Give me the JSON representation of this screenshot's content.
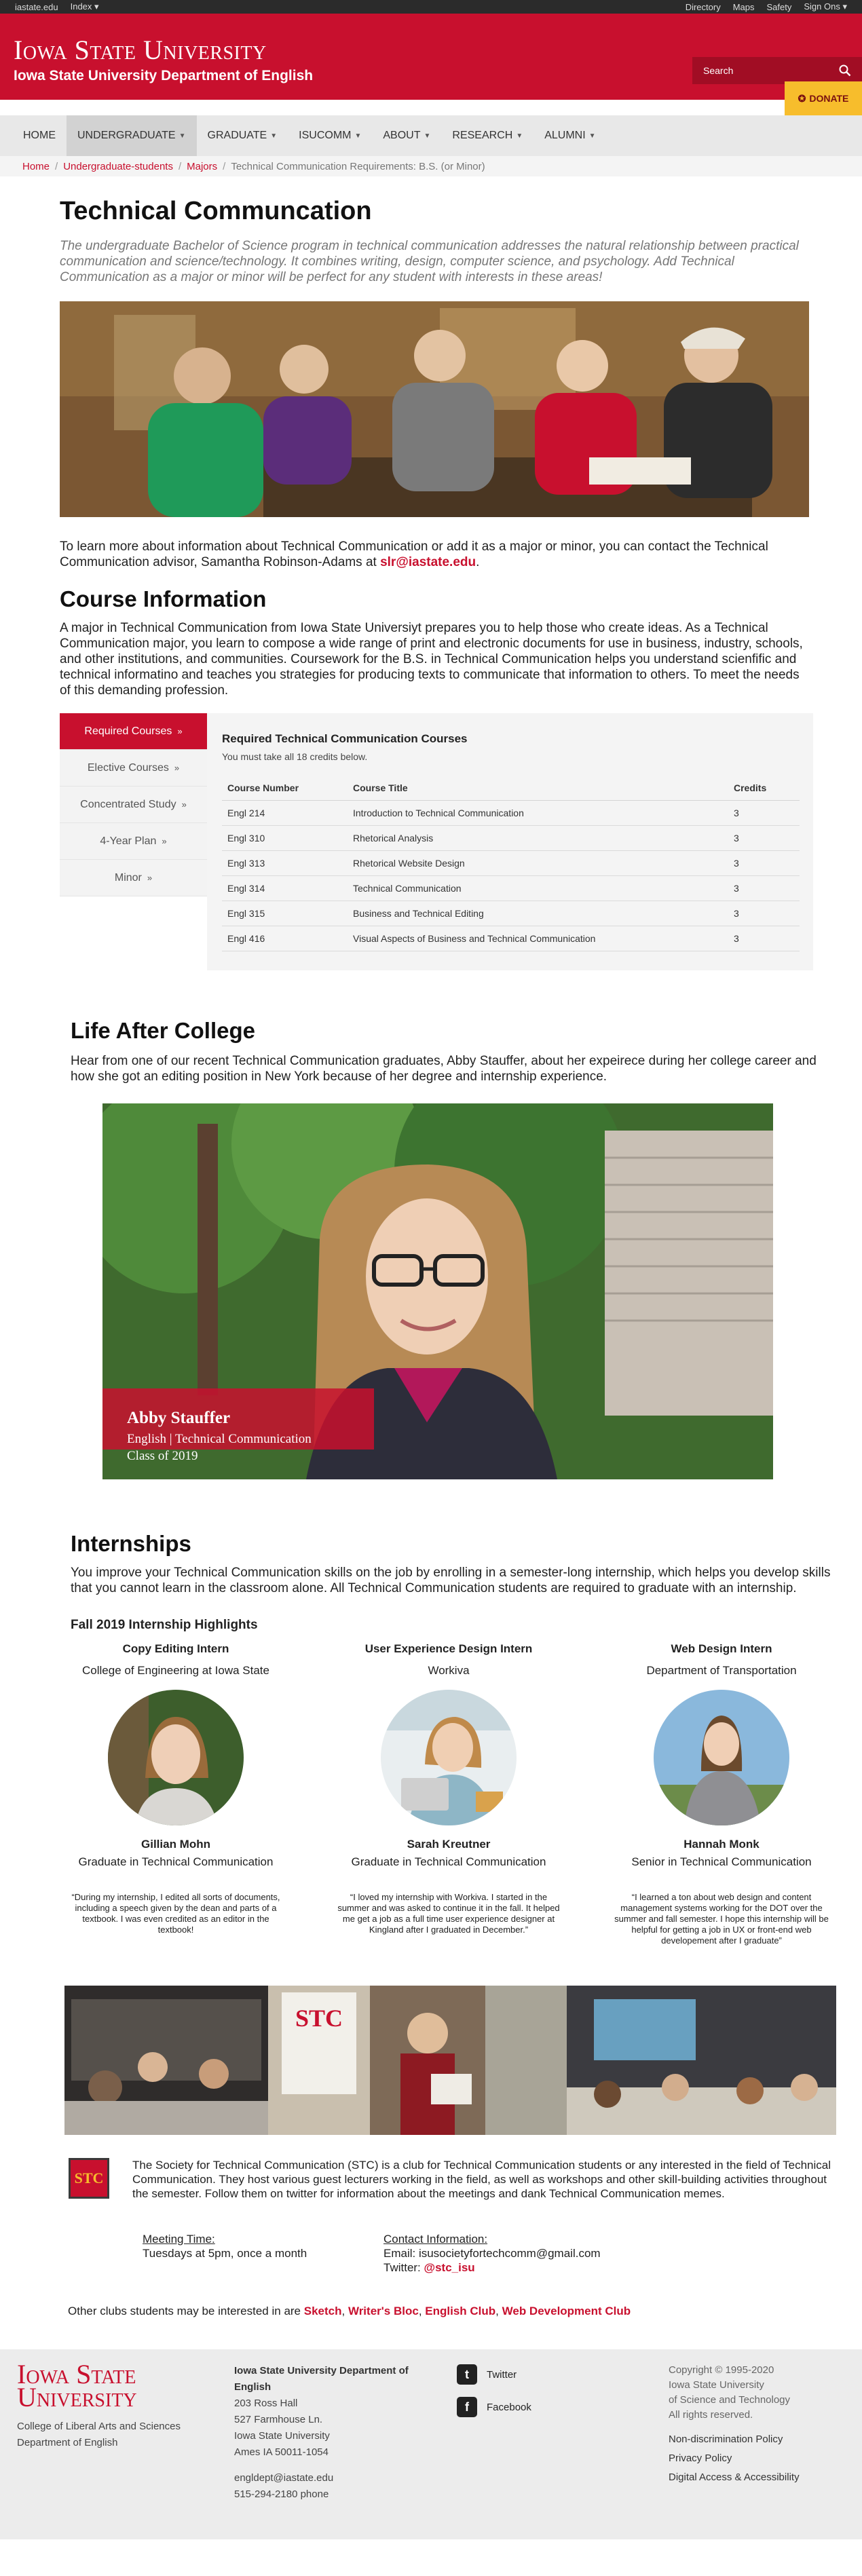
{
  "util": {
    "site": "iastate.edu",
    "index": "Index",
    "links": [
      "Directory",
      "Maps",
      "Safety",
      "Sign Ons"
    ]
  },
  "header": {
    "wordmark": "Iowa State University",
    "dept": "Iowa State University Department of English",
    "search_placeholder": "Search",
    "donate": "DONATE"
  },
  "nav": [
    "HOME",
    "UNDERGRADUATE",
    "GRADUATE",
    "ISUCOMM",
    "ABOUT",
    "RESEARCH",
    "ALUMNI"
  ],
  "breadcrumb": [
    "Home",
    "Undergraduate-students",
    "Majors",
    "Technical Communication Requirements: B.S. (or Minor)"
  ],
  "intro": {
    "title": "Technical Communcation",
    "lead": "The undergraduate Bachelor of Science program in technical communication addresses the natural relationship between practical communication and science/technology. It combines writing, design, computer science, and psychology. Add Technical Communication as a major or minor will be perfect for any student with interests in these areas!",
    "contact_text": "To learn more about information about Technical Communication or add it as a major or minor, you can contact the Technical Communication advisor, Samantha Robinson-Adams at ",
    "contact_email": "slr@iastate.edu",
    "contact_end": "."
  },
  "course_info": {
    "heading": "Course Information",
    "body": "A major in Technical Communication from Iowa State Universiyt prepares you to help those who create ideas. As a Technical Communication major, you learn to compose a wide range of print and electronic documents for use in business, industry, schools, and other institutions, and communities. Coursework for the B.S. in Technical Communication helps you understand scienfific and technical informatino and teaches you strategies for producing texts to communicate that information to others. To meet the needs of this demanding profession.",
    "tabs": [
      "Required Courses",
      "Elective Courses",
      "Concentrated Study",
      "4-Year Plan",
      "Minor"
    ],
    "panel_title": "Required Technical Communication Courses",
    "panel_sub": "You must take all 18 credits below.",
    "columns": [
      "Course Number",
      "Course Title",
      "Credits"
    ],
    "rows": [
      [
        "Engl 214",
        "Introduction to Technical Communication",
        "3"
      ],
      [
        "Engl 310",
        "Rhetorical Analysis",
        "3"
      ],
      [
        "Engl 313",
        "Rhetorical Website Design",
        "3"
      ],
      [
        "Engl 314",
        "Technical Communication",
        "3"
      ],
      [
        "Engl 315",
        "Business and Technical Editing",
        "3"
      ],
      [
        "Engl 416",
        "Visual Aspects of Business and Technical Communication",
        "3"
      ]
    ]
  },
  "life": {
    "heading": "Life After College",
    "body": "Hear from one of our recent Technical Communication graduates, Abby Stauffer, about her expeirece during her college career and how she got an editing position in New York because of her degree and internship experience.",
    "caption_name": "Abby Stauffer",
    "caption_major": "English | Technical Communication",
    "caption_class": "Class of 2019"
  },
  "internships": {
    "heading": "Internships",
    "body": "You improve your Technical Communication skills on the job by enrolling in a semester-long internship, which helps you develop skills that you cannot learn in the classroom alone. All Technical Communication students are required to graduate with an internship.",
    "highlights": "Fall 2019 Internship Highlights",
    "cards": [
      {
        "role": "Copy Editing Intern",
        "org": "College of Engineering at Iowa State",
        "name": "Gillian Mohn",
        "desc": "Graduate in Technical Communication",
        "quote": "“During my internship, I edited all sorts of documents, including a speech given by the dean and parts of a textbook. I was even credited as an editor in the textbook!"
      },
      {
        "role": "User Experience Design Intern",
        "org": "Workiva",
        "name": "Sarah Kreutner",
        "desc": "Graduate in Technical Communication",
        "quote": "“I loved my internship with Workiva. I started in the summer and was asked to continue it in the fall. It helped me get a job as a full time user experience designer at Kingland after I graduated in December.”"
      },
      {
        "role": "Web Design Intern",
        "org": "Department of Transportation",
        "name": "Hannah Monk",
        "desc": "Senior in Technical Communication",
        "quote": "“I learned a ton about web design and content management systems working for the DOT over the summer and fall semester. I hope this internship will be helpful for getting a job in UX or front-end web developement after I graduate”"
      }
    ]
  },
  "stc": {
    "logo": "STC",
    "body": "The Society for Technical Communication (STC) is a club for Technical Communication students or any interested in the field of Technical Communication. They host various guest lecturers working in the field, as well as workshops and other skill-building activities throughout the semester. Follow them on twitter for information about the meetings and dank Technical Communication memes.",
    "meeting_label": "Meeting Time:",
    "meeting_value": "Tuesdays at 5pm, once a month",
    "contact_label": "Contact Information:",
    "email_line": "Email: isusocietyfortechcomm@gmail.com",
    "twitter_label": "Twitter: ",
    "twitter_handle": "@stc_isu",
    "clubs_text": "Other clubs students may be interested in are ",
    "clubs": [
      "Sketch",
      "Writer's Bloc",
      "English Club",
      "Web Development Club"
    ]
  },
  "footer": {
    "wordmark_1": "Iowa State",
    "wordmark_2": "University",
    "college": "College of Liberal Arts and Sciences",
    "dept": "Department of English",
    "addr_title_1": "Iowa State University Department of",
    "addr_title_2": "English",
    "addr": [
      "203 Ross Hall",
      "527 Farmhouse Ln.",
      "Iowa State University",
      "Ames IA 50011-1054"
    ],
    "email": "engldept@iastate.edu",
    "phone": "515-294-2180 phone",
    "twitter": "Twitter",
    "facebook": "Facebook",
    "copyright": [
      "Copyright © 1995-2020",
      "Iowa State University",
      "of Science and Technology",
      "All rights reserved."
    ],
    "links": [
      "Non-discrimination Policy",
      "Privacy Policy",
      "Digital Access & Accessibility"
    ]
  }
}
